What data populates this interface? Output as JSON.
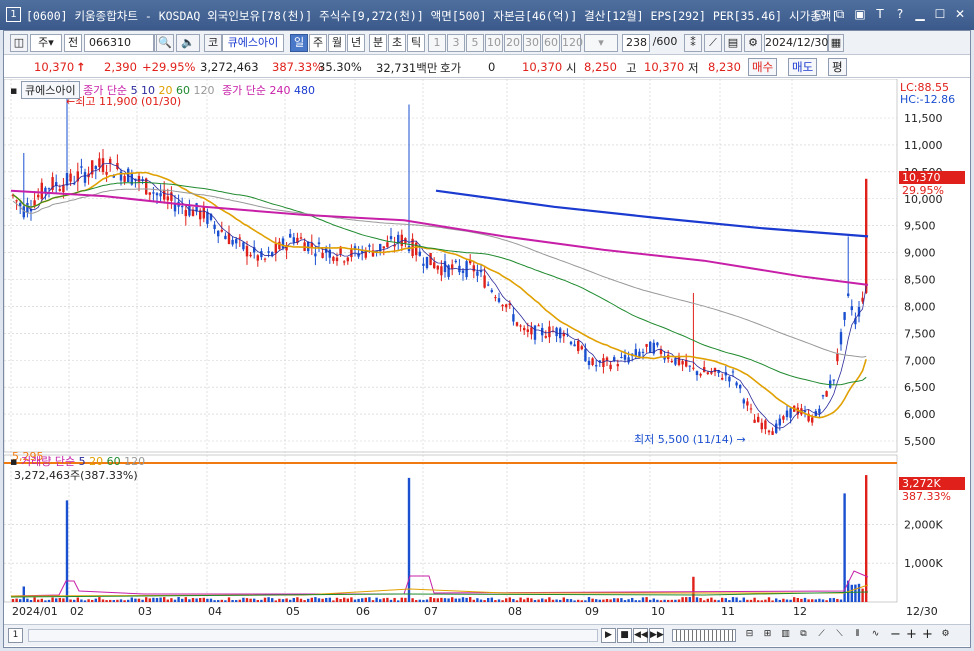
{
  "window": {
    "number": "1",
    "title": "[0600] 키움종합차트 - KOSDAQ 외국인보유[78(천)] 주식수[9,272(천)] 액면[500] 자본금[46(억)] 결산[12월] EPS[292] PER[35.46] 시가총액["
  },
  "toolbar": {
    "period": "주",
    "prev": "전",
    "code": "066310",
    "market": "코",
    "name": "큐에스아이",
    "tabs": [
      "일",
      "주",
      "월",
      "년",
      "분",
      "초",
      "틱"
    ],
    "active_tab": "일",
    "intervals": [
      "1",
      "3",
      "5",
      "10",
      "20",
      "30",
      "60",
      "120"
    ],
    "count": "238",
    "count_total": "/600",
    "date": "2024/12/30"
  },
  "quote": {
    "price": "10,370",
    "arrow": "↑",
    "change": "2,390",
    "change_pct": "+29.95%",
    "volume": "3,272,463",
    "volume_ratio": "387.33%",
    "turnover_ratio": "35.30%",
    "amount": "32,731백만",
    "hoga_label": "호가",
    "hoga_value": "0",
    "ask": "10,370",
    "open_label": "시",
    "open": "8,250",
    "high_label": "고",
    "high": "10,370",
    "low_label": "저",
    "low": "8,230",
    "buy": "매수",
    "sell": "매도",
    "eval": "평"
  },
  "price_panel": {
    "stock_tag": "큐에스아이",
    "ma_label": "종가 단순",
    "ma_periods": [
      {
        "p": "5",
        "color": "#2a2a9c"
      },
      {
        "p": "10",
        "color": "#2a2a9c"
      },
      {
        "p": "20",
        "color": "#e0a000"
      },
      {
        "p": "60",
        "color": "#1f8a2e"
      },
      {
        "p": "120",
        "color": "#999999"
      }
    ],
    "ma_label2": "종가 단순",
    "ma_long": [
      {
        "p": "240",
        "color": "#c71fa8"
      },
      {
        "p": "480",
        "color": "#1a3ad0"
      }
    ],
    "high_note": "최고 11,900 (01/30)",
    "low_note": "최저 5,500 (11/14)",
    "level_line": "5,295",
    "lc": "LC:88.55",
    "hc": "HC:-12.86",
    "current_price": "10,370",
    "current_pct": "29.95%",
    "y_ticks": [
      "11,500",
      "11,000",
      "10,500",
      "10,000",
      "9,500",
      "9,000",
      "8,500",
      "8,000",
      "7,500",
      "7,000",
      "6,500",
      "6,000",
      "5,500"
    ]
  },
  "volume_panel": {
    "label": "거래량",
    "ma_label": "단순",
    "ma_periods": [
      {
        "p": "5",
        "color": "#2a2a9c"
      },
      {
        "p": "20",
        "color": "#e0a000"
      },
      {
        "p": "60",
        "color": "#1f8a2e"
      },
      {
        "p": "120",
        "color": "#999999"
      }
    ],
    "value_text": "3,272,463주(387.33%)",
    "current": "3,272K",
    "current_pct": "387.33%",
    "y_ticks": [
      "2,000K",
      "1,000K"
    ]
  },
  "x_axis": {
    "labels": [
      "2024/01",
      "02",
      "03",
      "04",
      "05",
      "06",
      "07",
      "08",
      "09",
      "10",
      "11",
      "12"
    ],
    "end_label": "12/30"
  },
  "colors": {
    "up": "#e0201a",
    "down": "#1a4fd0",
    "ma240": "#c71fa8",
    "ma480": "#1a3ad0",
    "ma20": "#e0a000",
    "ma60": "#1f8a2e",
    "ma120": "#999999",
    "level": "#f07a10"
  },
  "chart_data": {
    "type": "candlestick",
    "xlabel": "",
    "ylabel": "",
    "ylim": [
      5250,
      11900
    ],
    "monthly_close_approx": {
      "months": [
        "2024/01",
        "02",
        "03",
        "04",
        "05",
        "06",
        "07",
        "08",
        "09",
        "10",
        "11",
        "12"
      ],
      "close": [
        10100,
        10650,
        9950,
        9200,
        9400,
        8950,
        8700,
        7600,
        7000,
        6950,
        5900,
        10370
      ]
    },
    "annotations": {
      "high": 11900,
      "high_date": "01/30",
      "low": 5500,
      "low_date": "11/14",
      "level": 5295
    }
  }
}
